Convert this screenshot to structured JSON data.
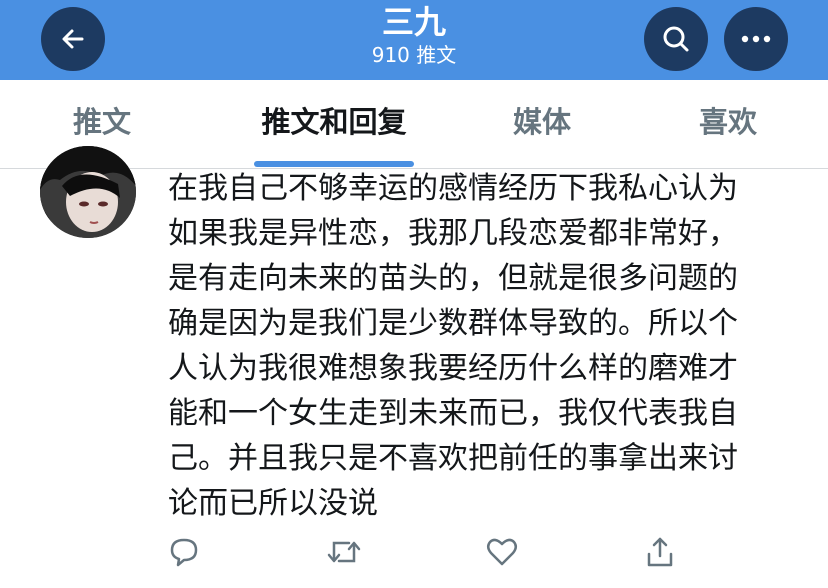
{
  "header": {
    "title": "三九",
    "subtitle": "910 推文",
    "bg_color": "#4a90e2",
    "button_color": "#1d3a61",
    "icons": [
      "back-arrow-icon",
      "search-icon",
      "more-icon"
    ]
  },
  "tabs": [
    {
      "label": "推文",
      "active": false
    },
    {
      "label": "推文和回复",
      "active": true
    },
    {
      "label": "媒体",
      "active": false
    },
    {
      "label": "喜欢",
      "active": false
    }
  ],
  "tweet": {
    "text": "在我自己不够幸运的感情经历下我私心认为\n如果我是异性恋，我那几段恋爱都非常好，\n是有走向未来的苗头的，但就是很多问题的\n确是因为是我们是少数群体导致的。所以个\n人认为我很难想象我要经历什么样的磨难才\n能和一个女生走到未来而已，我仅代表我自\n己。并且我只是不喜欢把前任的事拿出来讨\n论而已所以没说",
    "action_icons": [
      "reply-icon",
      "retweet-icon",
      "like-icon",
      "share-icon"
    ],
    "icon_color": "#66757f"
  }
}
